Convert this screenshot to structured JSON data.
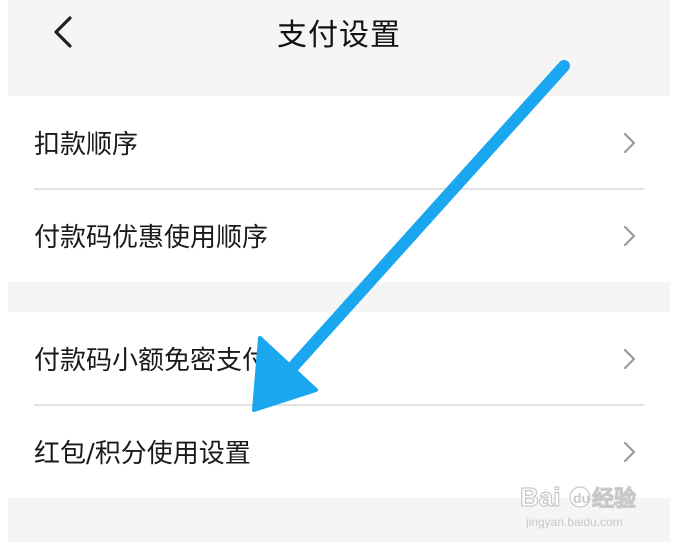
{
  "header": {
    "title": "支付设置",
    "back_icon": "chevron-left-icon"
  },
  "groups": [
    {
      "items": [
        {
          "label": "扣款顺序",
          "icon": "chevron-right-icon"
        },
        {
          "label": "付款码优惠使用顺序",
          "icon": "chevron-right-icon"
        }
      ]
    },
    {
      "items": [
        {
          "label": "付款码小额免密支付",
          "icon": "chevron-right-icon"
        },
        {
          "label": "红包/积分使用设置",
          "icon": "chevron-right-icon"
        }
      ]
    }
  ],
  "annotation": {
    "arrow_color": "#1aa7f0",
    "icon": "arrow-down-left-icon"
  },
  "watermark": {
    "brand": "Baidu经验",
    "url": "jingyan.baidu.com"
  },
  "colors": {
    "background": "#f5f5f5",
    "card": "#ffffff",
    "divider": "#e2e2e2",
    "text": "#1a1a1a",
    "chevron": "#9a9a9a"
  }
}
